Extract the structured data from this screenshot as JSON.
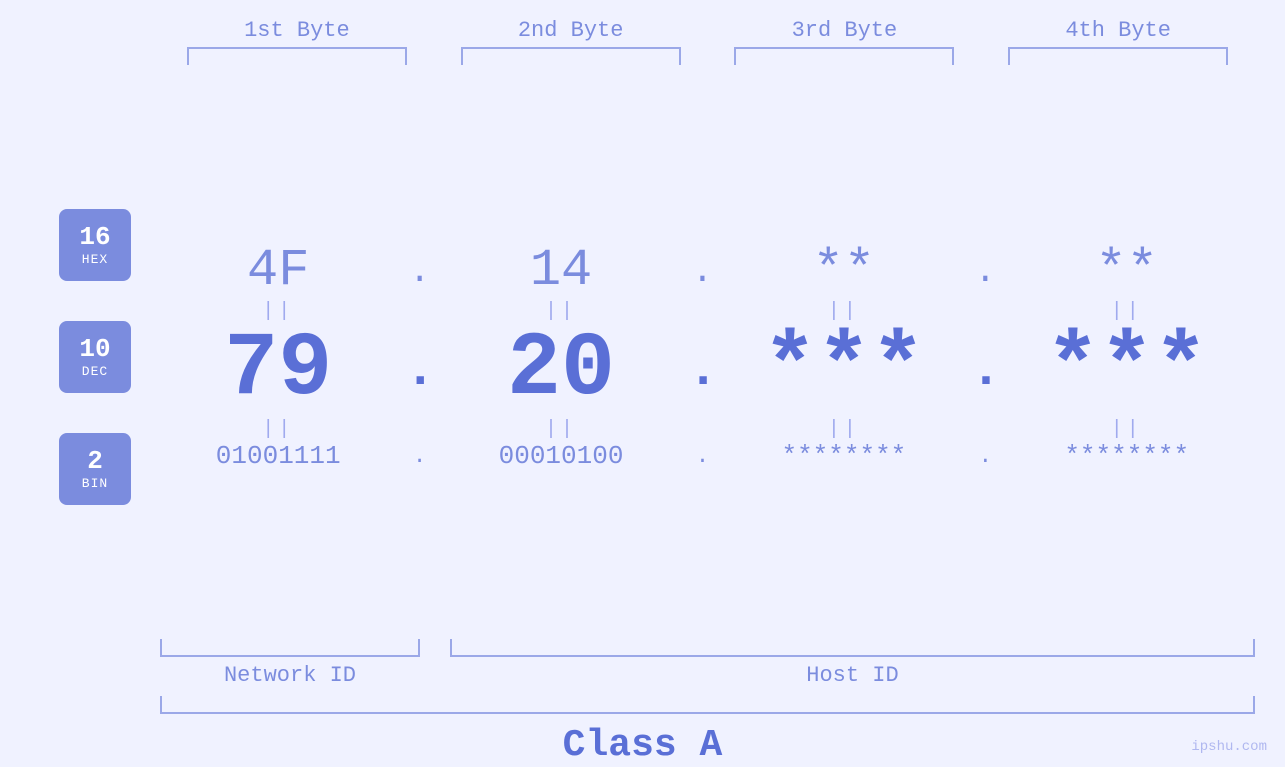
{
  "byteHeaders": [
    "1st Byte",
    "2nd Byte",
    "3rd Byte",
    "4th Byte"
  ],
  "badges": [
    {
      "num": "16",
      "label": "HEX"
    },
    {
      "num": "10",
      "label": "DEC"
    },
    {
      "num": "2",
      "label": "BIN"
    }
  ],
  "hexRow": {
    "values": [
      "4F",
      "14",
      "**",
      "**"
    ],
    "dots": [
      ".",
      ".",
      ".",
      ""
    ]
  },
  "decRow": {
    "values": [
      "79",
      "20",
      "***",
      "***"
    ],
    "dots": [
      ".",
      ".",
      ".",
      ""
    ]
  },
  "binRow": {
    "values": [
      "01001111",
      "00010100",
      "********",
      "********"
    ],
    "dots": [
      ".",
      ".",
      ".",
      ""
    ]
  },
  "equalsSymbol": "||",
  "bottomLabels": {
    "networkId": "Network ID",
    "hostId": "Host ID"
  },
  "classLabel": "Class A",
  "watermark": "ipshu.com"
}
